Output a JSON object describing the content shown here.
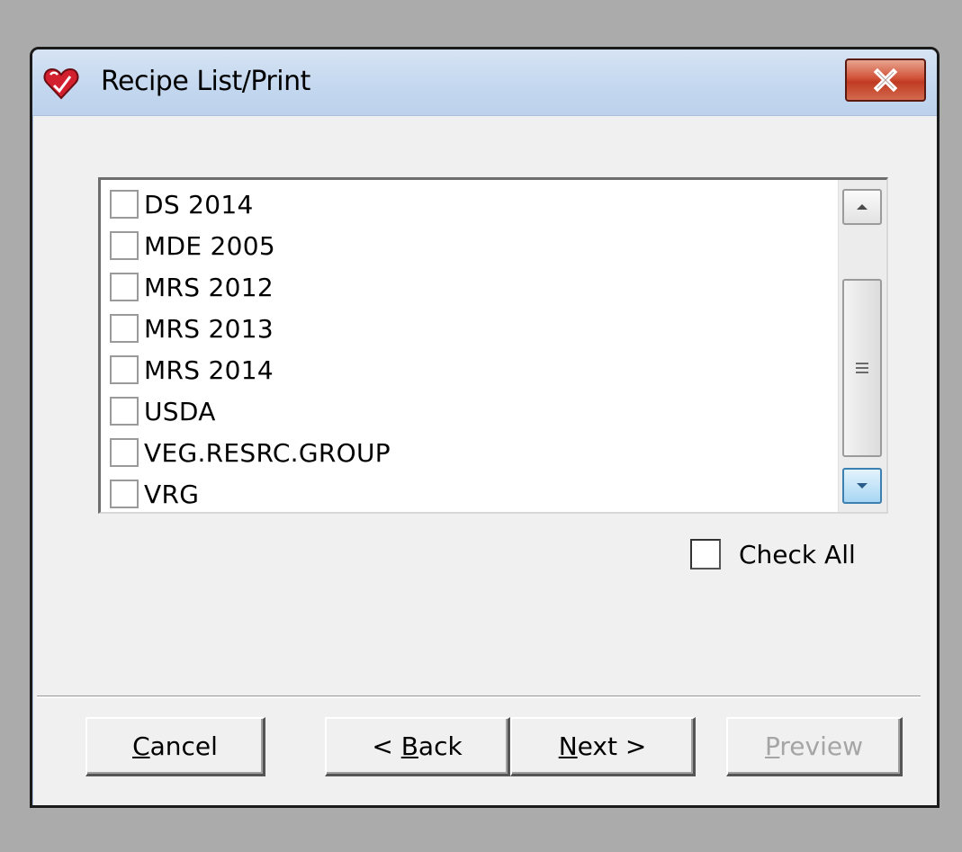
{
  "window": {
    "title": "Recipe List/Print",
    "close_icon": "close-icon"
  },
  "list": {
    "items": [
      {
        "label": "DS 2014",
        "checked": false
      },
      {
        "label": "MDE 2005",
        "checked": false
      },
      {
        "label": "MRS 2012",
        "checked": false
      },
      {
        "label": "MRS 2013",
        "checked": false
      },
      {
        "label": "MRS 2014",
        "checked": false
      },
      {
        "label": "USDA",
        "checked": false
      },
      {
        "label": "VEG.RESRC.GROUP",
        "checked": false
      },
      {
        "label": "VRG",
        "checked": false
      }
    ]
  },
  "check_all": {
    "label": "Check All",
    "checked": false
  },
  "buttons": {
    "cancel": {
      "label": "Cancel",
      "mnemonic": "C",
      "rest": "ancel"
    },
    "back": {
      "label": "< Back",
      "prefix": "< ",
      "mnemonic": "B",
      "rest": "ack"
    },
    "next": {
      "label": "Next >",
      "mnemonic": "N",
      "rest": "ext >"
    },
    "preview": {
      "label": "Preview",
      "mnemonic": "P",
      "rest": "review",
      "enabled": false
    }
  },
  "colors": {
    "title_bar": "#c3d7ef",
    "close_button": "#c03a22",
    "dialog_bg": "#f0f0f0",
    "desktop_bg": "#ababab"
  }
}
